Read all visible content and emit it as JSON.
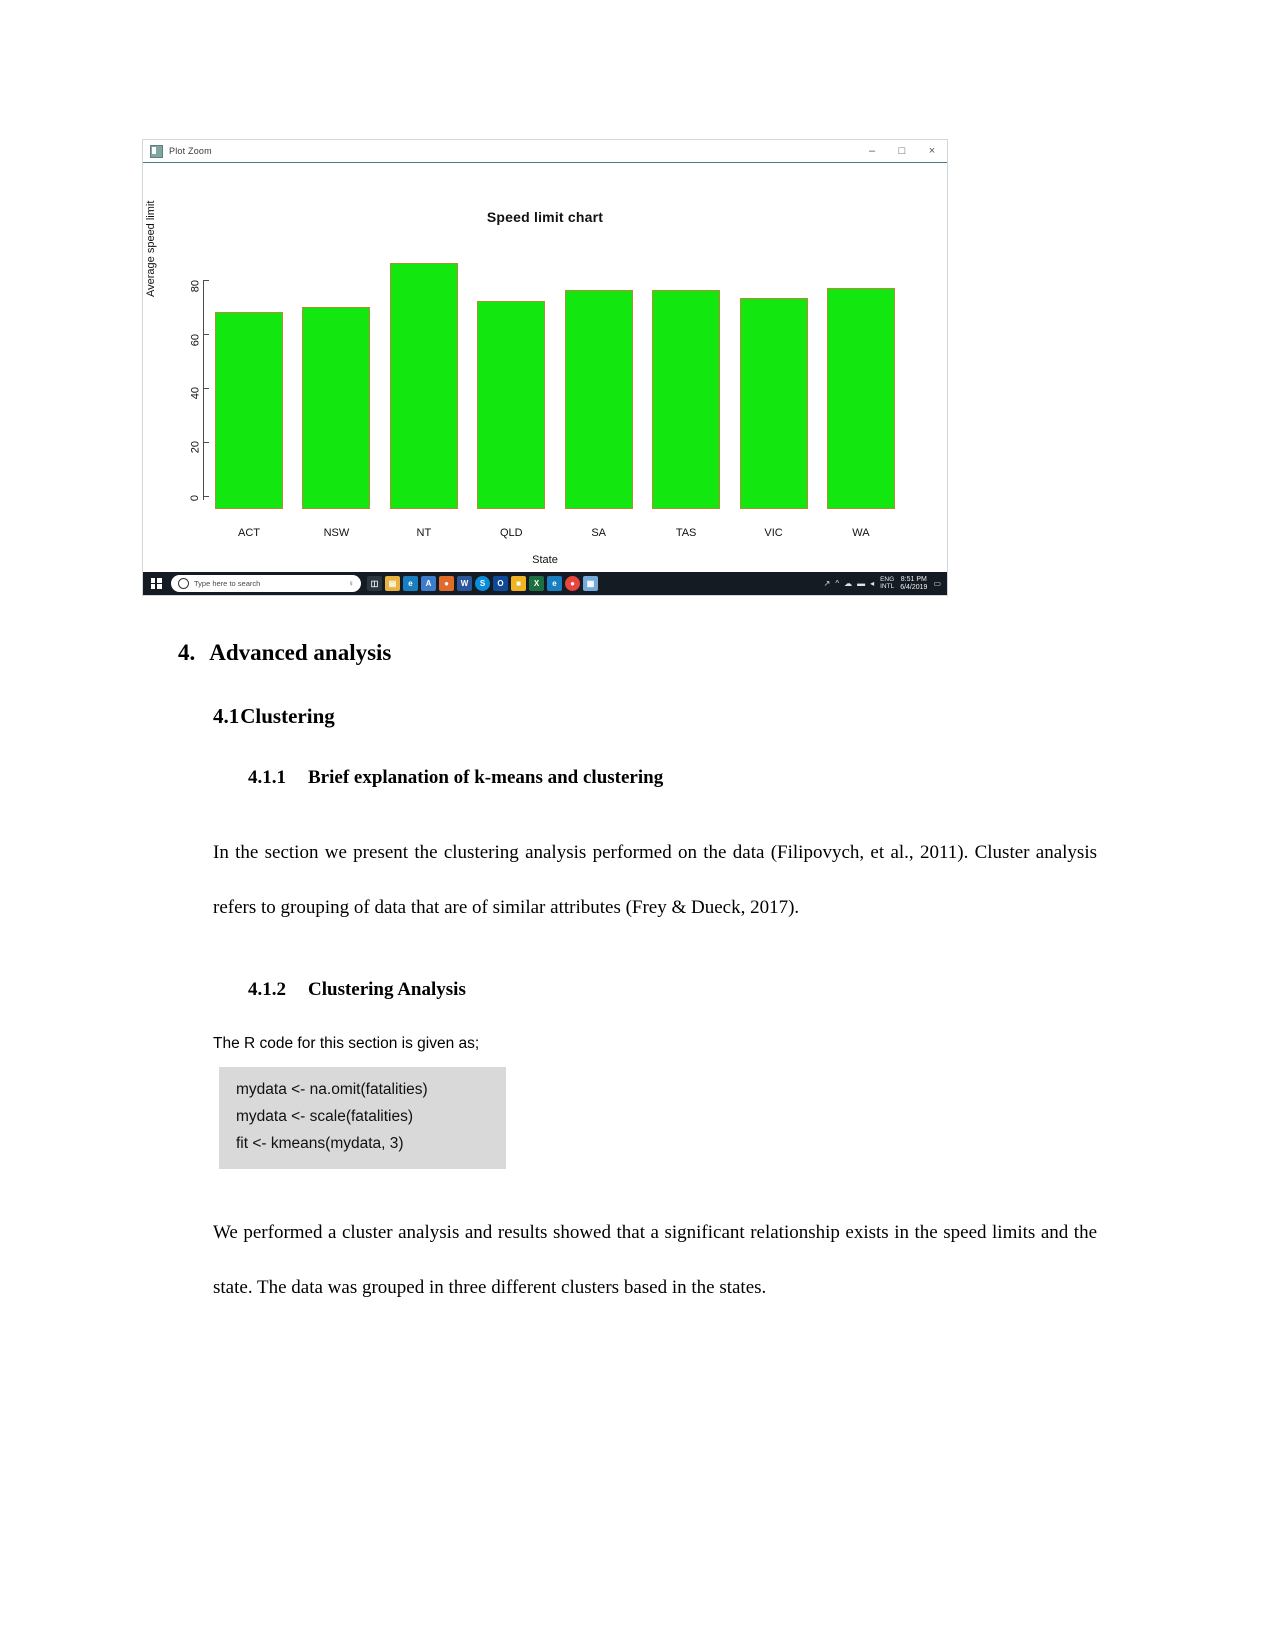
{
  "screenshot": {
    "window_title": "Plot Zoom",
    "window_icon": "r-plot-icon",
    "controls": {
      "minimize": "–",
      "maximize": "□",
      "close": "×"
    }
  },
  "chart_data": {
    "type": "bar",
    "title": "Speed limit chart",
    "xlabel": "State",
    "ylabel": "Average speed limit",
    "categories": [
      "ACT",
      "NSW",
      "NT",
      "QLD",
      "SA",
      "TAS",
      "VIC",
      "WA"
    ],
    "values": [
      73,
      75,
      91,
      77,
      81,
      81,
      78,
      82
    ],
    "yticks": [
      "0",
      "20",
      "40",
      "60",
      "80"
    ],
    "ylim": [
      0,
      91
    ],
    "grid": false,
    "legend": "none",
    "bar_color": "#12e80f",
    "bar_border_color": "#b08c32"
  },
  "taskbar": {
    "start_label": "windows-start",
    "search_placeholder": "Type here to search",
    "mic_icon": "♀",
    "task_view_icon": "task-view-icon",
    "apps": [
      {
        "name": "file-explorer",
        "glyph": "▤",
        "color": "#e8b341"
      },
      {
        "name": "edge-browser",
        "glyph": "e",
        "color": "#1a7fc1"
      },
      {
        "name": "adobe-reader",
        "glyph": "A",
        "color": "#3d7ccc"
      },
      {
        "name": "app-orange",
        "glyph": "●",
        "color": "#e06b2a"
      },
      {
        "name": "word",
        "glyph": "W",
        "color": "#2b579a"
      },
      {
        "name": "skype",
        "glyph": "S",
        "color": "#0c8ddb"
      },
      {
        "name": "outlook",
        "glyph": "O",
        "color": "#0f4a9a"
      },
      {
        "name": "app-yellow",
        "glyph": "■",
        "color": "#f0b323"
      },
      {
        "name": "excel",
        "glyph": "X",
        "color": "#1d6f42"
      },
      {
        "name": "edge-browser-2",
        "glyph": "e",
        "color": "#1a7fc1"
      },
      {
        "name": "chrome",
        "glyph": "●",
        "color": "#e8453c"
      },
      {
        "name": "rstudio",
        "glyph": "▦",
        "color": "#75aadb"
      }
    ],
    "tray": {
      "onedrive": "☁",
      "network": "▬",
      "volume": "◂",
      "language_line1": "ENG",
      "language_line2": "INTL",
      "time": "8:51 PM",
      "date": "6/4/2019",
      "notifications": "▭"
    }
  },
  "document": {
    "heading_2": {
      "number": "4.",
      "text": "Advanced analysis"
    },
    "heading_3": {
      "number": "4.1",
      "text": "Clustering"
    },
    "heading_4_1": {
      "number": "4.1.1",
      "text": "Brief explanation of k-means and clustering"
    },
    "paragraph_1": "In the section we present the clustering analysis performed on the data (Filipovych, et al., 2011). Cluster analysis refers to grouping of data that are of similar attributes (Frey & Dueck, 2017).",
    "heading_4_2": {
      "number": "4.1.2",
      "text": "Clustering Analysis"
    },
    "code_intro": "The R code for this section is given as;",
    "code_lines": [
      "mydata <- na.omit(fatalities)",
      "mydata <- scale(fatalities)",
      "fit <- kmeans(mydata, 3)"
    ],
    "paragraph_2": "We performed a cluster analysis and results showed that a significant relationship exists in the speed limits and the state. The data was grouped in three different clusters based in the states."
  }
}
